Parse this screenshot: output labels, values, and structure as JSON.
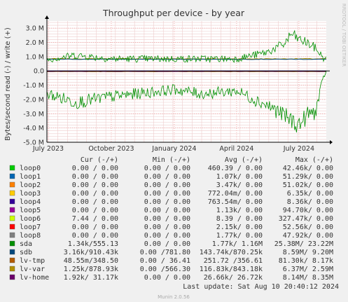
{
  "chart_data": {
    "type": "line",
    "title": "Throughput per device - by year",
    "ylabel": "Bytes/second read (-) / write (+)",
    "side_label": "RRDTOOL / TOBI OETIKER",
    "ylim": [
      -5.0,
      3.5
    ],
    "y_ticks": [
      "3.0 M",
      "2.0 M",
      "1.0 M",
      "0.0",
      "-1.0 M",
      "-2.0 M",
      "-3.0 M",
      "-4.0 M",
      "-5.0 M"
    ],
    "y_tick_values": [
      3,
      2,
      1,
      0,
      -1,
      -2,
      -3,
      -4,
      -5
    ],
    "x_ticks": [
      "July 2023",
      "October 2023",
      "January 2024",
      "April 2024",
      "July 2024"
    ],
    "x_tick_values": [
      "2023-07-01",
      "2023-10-01",
      "2024-01-01",
      "2024-04-01",
      "2024-07-01"
    ],
    "x_range": [
      "2023-06-29",
      "2024-08-10"
    ],
    "grid": true,
    "sda_write_profile": {
      "x": [
        "2023-06-29",
        "2023-08-10",
        "2023-10-01",
        "2024-01-01",
        "2024-04-01",
        "2024-05-15",
        "2024-06-10",
        "2024-06-20",
        "2024-07-01",
        "2024-07-12",
        "2024-07-25",
        "2024-08-08"
      ],
      "y": [
        0.8,
        1.1,
        0.85,
        0.85,
        0.85,
        1.3,
        1.9,
        2.6,
        2.2,
        2.0,
        1.6,
        0.8
      ]
    },
    "sda_read_profile": {
      "x": [
        "2023-06-29",
        "2023-08-10",
        "2023-10-01",
        "2024-01-01",
        "2024-02-10",
        "2024-04-01",
        "2024-05-20",
        "2024-06-15",
        "2024-07-01",
        "2024-07-15",
        "2024-07-25",
        "2024-08-08"
      ],
      "y": [
        -1.6,
        -2.2,
        -1.8,
        -1.3,
        -1.6,
        -1.4,
        -2.5,
        -3.3,
        -3.8,
        -3.0,
        -2.9,
        -0.1
      ]
    },
    "legend": {
      "headers": [
        "Cur (-/+)",
        "Min (-/+)",
        "Avg (-/+)",
        "Max (-/+)"
      ],
      "rows": [
        {
          "name": "loop0",
          "color": "#00cc00",
          "cur": "0.00 /  0.00",
          "min": "0.00 /  0.00",
          "avg": "460.39 /  0.00",
          "max": "42.46k/  0.00"
        },
        {
          "name": "loop1",
          "color": "#0066b3",
          "cur": "0.00 /  0.00",
          "min": "0.00 /  0.00",
          "avg": "1.07k/  0.00",
          "max": "51.29k/  0.00"
        },
        {
          "name": "loop2",
          "color": "#ff8000",
          "cur": "0.00 /  0.00",
          "min": "0.00 /  0.00",
          "avg": "3.47k/  0.00",
          "max": "51.02k/  0.00"
        },
        {
          "name": "loop3",
          "color": "#ffcc00",
          "cur": "0.00 /  0.00",
          "min": "0.00 /  0.00",
          "avg": "772.04m/  0.00",
          "max": "6.35k/  0.00"
        },
        {
          "name": "loop4",
          "color": "#330099",
          "cur": "0.00 /  0.00",
          "min": "0.00 /  0.00",
          "avg": "763.54m/  0.00",
          "max": "8.36k/  0.00"
        },
        {
          "name": "loop5",
          "color": "#990099",
          "cur": "0.00 /  0.00",
          "min": "0.00 /  0.00",
          "avg": "1.13k/  0.00",
          "max": "94.70k/  0.00"
        },
        {
          "name": "loop6",
          "color": "#ccff00",
          "cur": "7.44 /  0.00",
          "min": "0.00 /  0.00",
          "avg": "8.39 /  0.00",
          "max": "327.47k/  0.00"
        },
        {
          "name": "loop7",
          "color": "#ff0000",
          "cur": "0.00 /  0.00",
          "min": "0.00 /  0.00",
          "avg": "2.15k/  0.00",
          "max": "52.56k/  0.00"
        },
        {
          "name": "loop8",
          "color": "#808080",
          "cur": "0.00 /  0.00",
          "min": "0.00 /  0.00",
          "avg": "1.77k/  0.00",
          "max": "47.92k/  0.00"
        },
        {
          "name": "sda",
          "color": "#008f00",
          "cur": "1.34k/555.13",
          "min": "0.00 /  0.00",
          "avg": "1.77k/  1.16M",
          "max": "25.38M/ 23.22M"
        },
        {
          "name": "sdb",
          "color": "#00487d",
          "cur": "3.16k/910.43k",
          "min": "0.00 /781.80",
          "avg": "143.74k/870.25k",
          "max": "8.59M/  9.20M"
        },
        {
          "name": "lv-tmp",
          "color": "#b35a00",
          "cur": "48.55m/348.50",
          "min": "0.00 / 36.41",
          "avg": "251.72 /356.61",
          "max": "81.30k/  8.17k"
        },
        {
          "name": "lv-var",
          "color": "#b38f00",
          "cur": "1.25k/878.93k",
          "min": "0.00 /566.30",
          "avg": "116.83k/843.18k",
          "max": "6.37M/  2.59M"
        },
        {
          "name": "lv-home",
          "color": "#6b006b",
          "cur": "1.92k/ 31.17k",
          "min": "0.00 /  0.00",
          "avg": "26.66k/ 26.72k",
          "max": "8.14M/  8.35M"
        }
      ]
    },
    "last_update": "Last update: Sat Aug 10 20:40:12 2024",
    "footer": "Munin 2.0.56"
  }
}
